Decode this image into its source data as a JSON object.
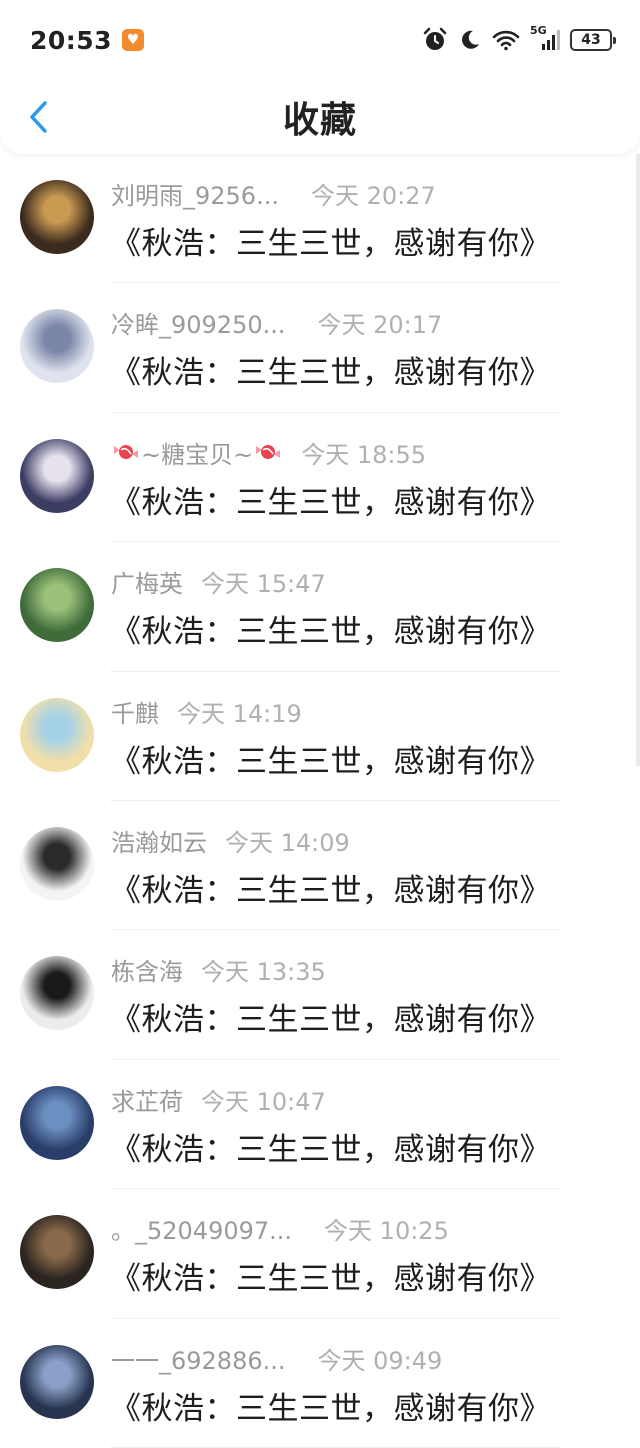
{
  "status_bar": {
    "time": "20:53",
    "app_badge": "♥",
    "network": "5G",
    "battery": "43"
  },
  "header": {
    "title": "收藏"
  },
  "items": [
    {
      "name": "刘明雨_9256...",
      "time": "今天 20:27",
      "message": "《秋浩：三生三世，感谢有你》",
      "avatar_colors": [
        "#3b2a1e",
        "#c99a52"
      ]
    },
    {
      "name": "冷眸_909250...",
      "time": "今天 20:17",
      "message": "《秋浩：三生三世，感谢有你》",
      "avatar_colors": [
        "#dfe3ee",
        "#7b86a8"
      ]
    },
    {
      "name": "~糖宝贝~",
      "time": "今天 18:55",
      "message": "《秋浩：三生三世，感谢有你》",
      "avatar_colors": [
        "#3b3d63",
        "#e7e1ee"
      ]
    },
    {
      "name": "广梅英",
      "time": "今天 15:47",
      "message": "《秋浩：三生三世，感谢有你》",
      "avatar_colors": [
        "#3f6b3a",
        "#9bc07a"
      ]
    },
    {
      "name": "千麒",
      "time": "今天 14:19",
      "message": "《秋浩：三生三世，感谢有你》",
      "avatar_colors": [
        "#f1dfa9",
        "#a6d2e8"
      ]
    },
    {
      "name": "浩瀚如云",
      "time": "今天 14:09",
      "message": "《秋浩：三生三世，感谢有你》",
      "avatar_colors": [
        "#f4f4f4",
        "#2a2a2a"
      ]
    },
    {
      "name": "栋含海",
      "time": "今天 13:35",
      "message": "《秋浩：三生三世，感谢有你》",
      "avatar_colors": [
        "#ececec",
        "#1a1a1a"
      ]
    },
    {
      "name": "求芷荷",
      "time": "今天 10:47",
      "message": "《秋浩：三生三世，感谢有你》",
      "avatar_colors": [
        "#2b3e6a",
        "#6c8fc2"
      ]
    },
    {
      "name": "。_52049097...",
      "time": "今天 10:25",
      "message": "《秋浩：三生三世，感谢有你》",
      "avatar_colors": [
        "#2b2520",
        "#8a6a4a"
      ]
    },
    {
      "name": "一一_692886...",
      "time": "今天 09:49",
      "message": "《秋浩：三生三世，感谢有你》",
      "avatar_colors": [
        "#26344f",
        "#8aa0c8"
      ]
    }
  ]
}
